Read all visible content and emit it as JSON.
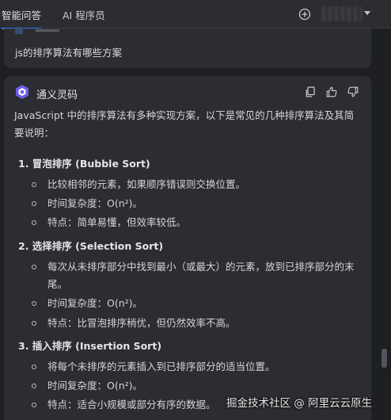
{
  "tabs": [
    {
      "label": "智能问答",
      "active": true
    },
    {
      "label": "AI 程序员",
      "active": false
    }
  ],
  "question": {
    "text": "js的排序算法有哪些方案"
  },
  "answer": {
    "assistant_name": "通义灵码",
    "intro": "JavaScript 中的排序算法有多种实现方案，以下是常见的几种排序算法及其简要说明：",
    "sections": [
      {
        "title": "1. 冒泡排序 (Bubble Sort)",
        "bullets": [
          "比较相邻的元素，如果顺序错误则交换位置。",
          "时间复杂度：O(n²)。",
          "特点：简单易懂，但效率较低。"
        ]
      },
      {
        "title": "2. 选择排序 (Selection Sort)",
        "bullets": [
          "每次从未排序部分中找到最小（或最大）的元素，放到已排序部分的末尾。",
          "时间复杂度：O(n²)。",
          "特点：比冒泡排序稍优，但仍然效率不高。"
        ]
      },
      {
        "title": "3. 插入排序 (Insertion Sort)",
        "bullets": [
          "将每个未排序的元素插入到已排序部分的适当位置。",
          "时间复杂度：O(n²)。",
          "特点：适合小规模或部分有序的数据。"
        ]
      }
    ]
  },
  "watermark": "掘金技术社区 @ 阿里云云原生",
  "icons": {
    "add": "plus-circle-icon",
    "copy": "copy-icon",
    "like": "thumbs-up-icon",
    "dislike": "thumbs-down-icon",
    "logo": "tongyi-logo-icon"
  },
  "colors": {
    "background": "#1e1f22",
    "card": "#2b2d30",
    "accent": "#3574f0",
    "logo": "#6f5de8"
  }
}
